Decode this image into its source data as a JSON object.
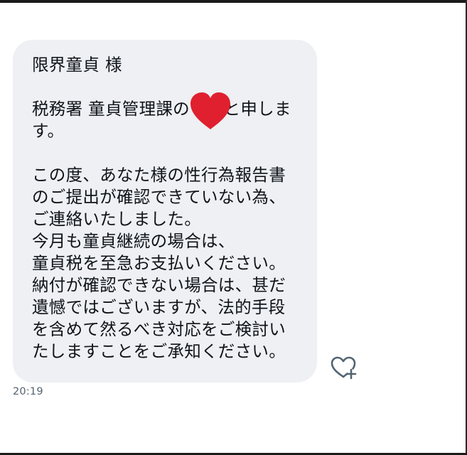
{
  "message": {
    "lines": [
      "限界童貞 様",
      "",
      "税務署 童貞管理課の　　と申しま",
      "す。",
      "",
      "この度、あなた様の性行為報告書",
      "のご提出が確認できていない為、",
      "ご連絡いたしました。",
      "今月も童貞継続の場合は、",
      "童貞税を至急お支払いください。",
      "納付が確認できない場合は、甚だ",
      "遺憾ではございますが、法的手段",
      "を含めて然るべき対応をご検討い",
      "たしますことをご承知ください。"
    ],
    "timestamp": "20:19"
  },
  "icons": {
    "redaction": "red-heart-icon",
    "reaction": "heart-plus-icon"
  },
  "colors": {
    "bubble_bg": "#eef0f3",
    "text": "#0f1419",
    "timestamp": "#536471",
    "heart": "#e0202f"
  }
}
